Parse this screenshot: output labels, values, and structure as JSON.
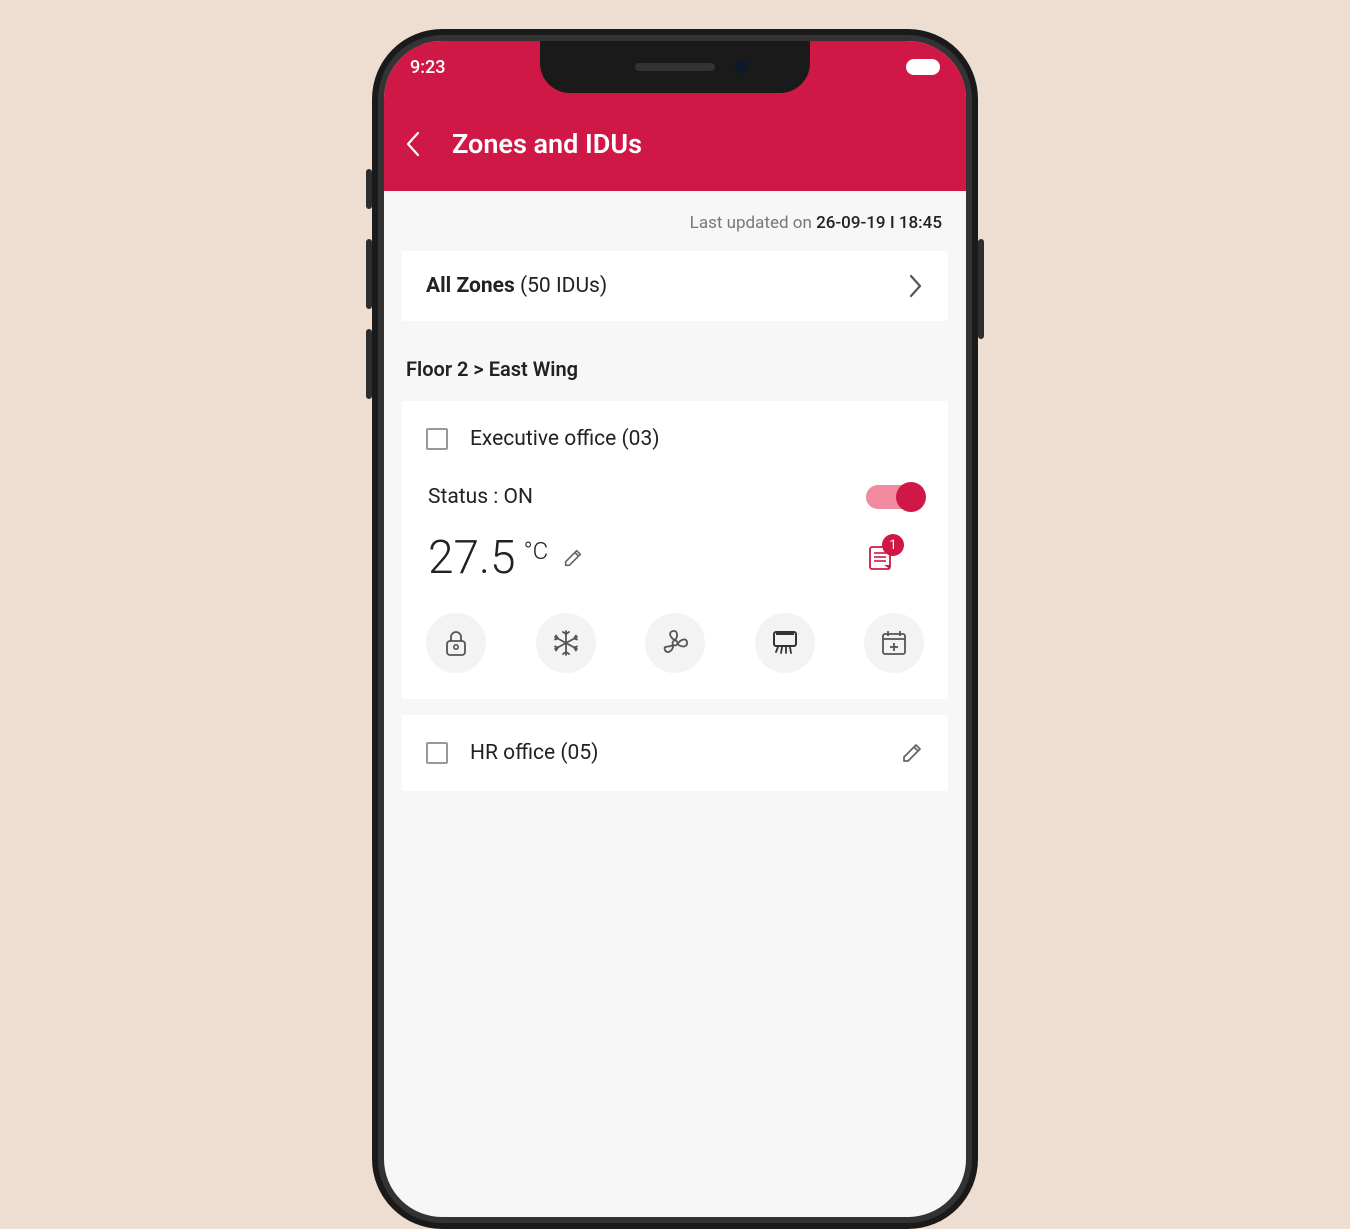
{
  "status_bar": {
    "time": "9:23"
  },
  "header": {
    "title": "Zones and IDUs"
  },
  "updated": {
    "prefix": "Last updated on ",
    "date": "26-09-19",
    "separator": "  I  ",
    "time": "18:45"
  },
  "all_zones": {
    "label_bold": "All Zones",
    "label_rest": " (50 IDUs)"
  },
  "breadcrumb": "Floor 2 > East Wing",
  "zones": [
    {
      "name": "Executive office (03)",
      "status_label": "Status : ON",
      "temperature": "27.5",
      "temp_unit": "°C",
      "notif_count": "1"
    },
    {
      "name": "HR office (05)"
    }
  ],
  "colors": {
    "accent": "#d01846"
  }
}
